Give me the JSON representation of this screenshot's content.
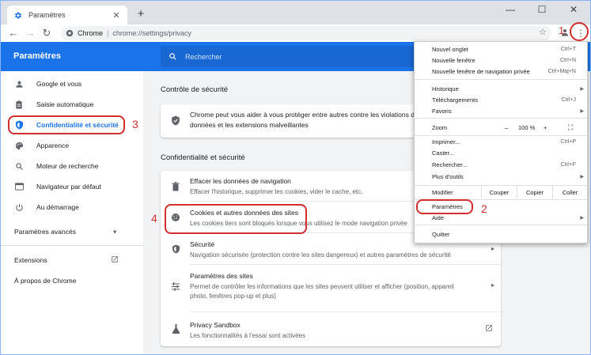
{
  "browser": {
    "tab_title": "Paramètres",
    "new_tab_symbol": "+",
    "minimize_symbol": "—",
    "maximize_symbol": "☐",
    "close_symbol": "✕",
    "tab_close_symbol": "✕",
    "back_symbol": "←",
    "forward_symbol": "→",
    "reload_symbol": "↻",
    "site_chip": "Chrome",
    "url": "chrome://settings/privacy",
    "bookmark_symbol": "☆",
    "menu_symbol": "⋮"
  },
  "settings_header": {
    "title": "Paramètres",
    "search_placeholder": "Rechercher"
  },
  "leftnav": {
    "items": [
      {
        "label": "Google et vous",
        "icon": "person-icon"
      },
      {
        "label": "Saisie automatique",
        "icon": "clipboard-icon"
      },
      {
        "label": "Confidentialité et sécurité",
        "icon": "shield-icon"
      },
      {
        "label": "Apparence",
        "icon": "palette-icon"
      },
      {
        "label": "Moteur de recherche",
        "icon": "search-icon"
      },
      {
        "label": "Navigateur par défaut",
        "icon": "browser-icon"
      },
      {
        "label": "Au démarrage",
        "icon": "power-icon"
      }
    ],
    "advanced_label": "Paramètres avancés",
    "advanced_arrow": "▾",
    "extensions_label": "Extensions",
    "about_label": "À propos de Chrome"
  },
  "main": {
    "safety_title": "Contrôle de sécurité",
    "safety_text_line1": "Chrome peut vous aider à vous protéger entre autres contre les violations de",
    "safety_text_line2": "données et les extensions malveillantes",
    "privacy_title": "Confidentialité et sécurité",
    "rows": [
      {
        "title": "Effacer les données de navigation",
        "sub": "Effacer l'historique, supprimer les cookies, vider le cache, etc."
      },
      {
        "title": "Cookies et autres données des sites",
        "sub": "Les cookies tiers sont bloqués lorsque vous utilisez le mode navigation privée"
      },
      {
        "title": "Sécurité",
        "sub": "Navigation sécurisée (protection contre les sites dangereux) et autres paramètres de sécurité"
      },
      {
        "title": "Paramètres des sites",
        "sub": "Permet de contrôler les informations que les sites peuvent utiliser et afficher (position, appareil photo, fenêtres pop-up et plus)"
      },
      {
        "title": "Privacy Sandbox",
        "sub": "Les fonctionnalités à l'essai sont activées"
      }
    ],
    "row_arrow": "▸"
  },
  "menu": {
    "new_tab": {
      "label": "Nouvel onglet",
      "shortcut": "Ctrl+T"
    },
    "new_window": {
      "label": "Nouvelle fenêtre",
      "shortcut": "Ctrl+N"
    },
    "new_incognito": {
      "label": "Nouvelle fenêtre de navigation privée",
      "shortcut": "Ctrl+Maj+N"
    },
    "history": {
      "label": "Historique"
    },
    "downloads": {
      "label": "Téléchargements",
      "shortcut": "Ctrl+J"
    },
    "bookmarks": {
      "label": "Favoris"
    },
    "zoom": {
      "label": "Zoom",
      "minus": "–",
      "value": "100 %",
      "plus": "+",
      "fullscreen": "⛶"
    },
    "print": {
      "label": "Imprimer...",
      "shortcut": "Ctrl+P"
    },
    "cast": {
      "label": "Caster..."
    },
    "find": {
      "label": "Rechercher...",
      "shortcut": "Ctrl+F"
    },
    "more_tools": {
      "label": "Plus d'outils"
    },
    "edit": {
      "label": "Modifier",
      "cut": "Couper",
      "copy": "Copier",
      "paste": "Coller"
    },
    "settings": {
      "label": "Paramètres"
    },
    "help": {
      "label": "Aide"
    },
    "quit": {
      "label": "Quitter"
    },
    "submenu_arrow": "▶"
  },
  "annotations": {
    "step1": "1",
    "step2": "2",
    "step3": "3",
    "step4": "4",
    "color": "#d32f2f"
  },
  "colors": {
    "accent": "#1a73e8"
  }
}
